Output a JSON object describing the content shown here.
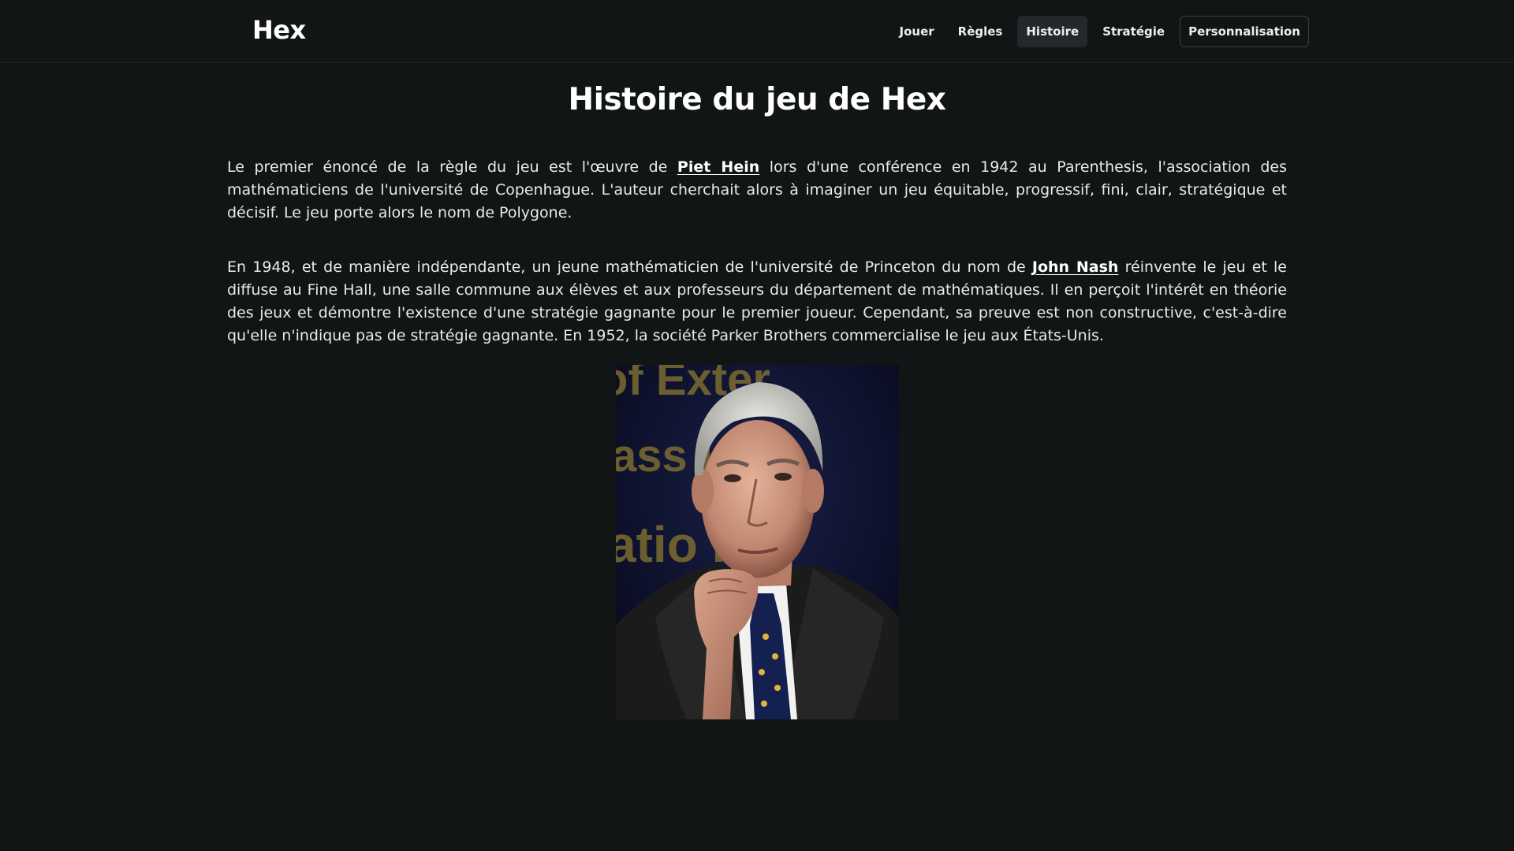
{
  "header": {
    "brand": "Hex",
    "nav": [
      {
        "label": "Jouer"
      },
      {
        "label": "Règles"
      },
      {
        "label": "Histoire"
      },
      {
        "label": "Stratégie"
      },
      {
        "label": "Personnalisation"
      }
    ]
  },
  "main": {
    "title": "Histoire du jeu de Hex",
    "paragraph1": {
      "before": "Le premier énoncé de la règle du jeu est l'œuvre de ",
      "link": "Piet Hein",
      "after": " lors d'une conférence en 1942 au Parenthesis, l'association des mathématiciens de l'université de Copenhague. L'auteur cherchait alors à imaginer un jeu équitable, progressif, fini, clair, stratégique et décisif. Le jeu porte alors le nom de Polygone."
    },
    "paragraph2": {
      "before": "En 1948, et de manière indépendante, un jeune mathématicien de l'université de Princeton du nom de ",
      "link": "John Nash",
      "after": " réinvente le jeu et le diffuse au Fine Hall, une salle commune aux élèves et aux professeurs du département de mathématiques. Il en perçoit l'intérêt en théorie des jeux et démontre l'existence d'une stratégie gagnante pour le premier joueur. Cependant, sa preuve est non constructive, c'est-à-dire qu'elle n'indique pas de stratégie gagnante. En 1952, la société Parker Brothers commercialise le jeu aux États-Unis."
    },
    "portrait": {
      "background_text": [
        "of Exter",
        "ass  ion",
        "atio  Inc"
      ]
    }
  },
  "colors": {
    "background": "#121515",
    "active_nav_bg": "#23282a",
    "text": "#f2f2f2"
  }
}
